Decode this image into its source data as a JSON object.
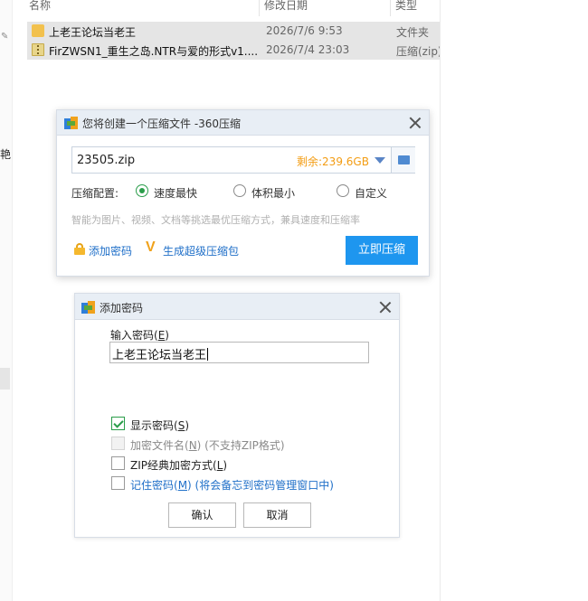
{
  "explorer": {
    "columns": {
      "name": "名称",
      "date": "修改日期",
      "type": "类型"
    },
    "files": [
      {
        "icon": "folder-icon",
        "name": "上老王论坛当老王",
        "date": "2026/7/6 9:53",
        "type": "文件夹"
      },
      {
        "icon": "zip-file-icon",
        "name": "FirZWSN1_重生之岛.NTR与爱的形式v1....",
        "date": "2026/7/4 23:03",
        "type": "压缩(zip)"
      }
    ],
    "left_edge_char": "艳"
  },
  "compress_dialog": {
    "title": "您将创建一个压缩文件 -360压缩",
    "filename": "23505.zip",
    "free_space": "剩余:239.6GB",
    "config_label": "压缩配置:",
    "options": [
      "速度最快",
      "体积最小",
      "自定义"
    ],
    "selected_option": "速度最快",
    "hint": "智能为图片、视频、文档等挑选最优压缩方式，兼具速度和压缩率",
    "add_password_link": "添加密码",
    "super_package_link": "生成超级压缩包",
    "compress_button": "立即压缩",
    "accent_color": "#1e96ef"
  },
  "password_dialog": {
    "title": "添加密码",
    "input_label": "输入密码(E)",
    "input_label_text": "输入密码(",
    "input_label_key": "E",
    "input_label_end": ")",
    "password_value": "上老王论坛当老王",
    "checkboxes": [
      {
        "text": "显示密码(",
        "key": "S",
        "end": ")",
        "checked": true,
        "disabled": false
      },
      {
        "text": "加密文件名(",
        "key": "N",
        "end": ") (不支持ZIP格式)",
        "checked": false,
        "disabled": true
      },
      {
        "text": "ZIP经典加密方式(",
        "key": "L",
        "end": ")",
        "checked": false,
        "disabled": false
      },
      {
        "text": "记住密码(",
        "key": "M",
        "end": ") (将会备忘到密码管理窗口中)",
        "checked": false,
        "disabled": false
      }
    ],
    "ok_button": "确认",
    "cancel_button": "取消"
  }
}
